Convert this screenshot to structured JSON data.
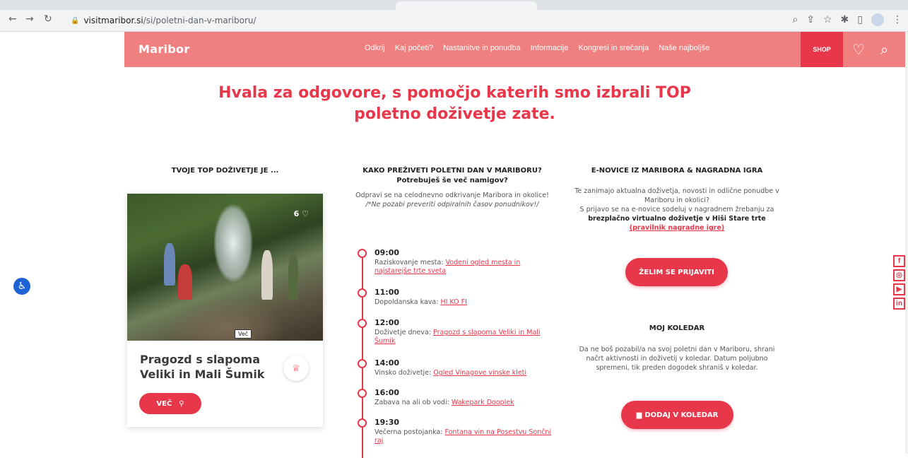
{
  "browser": {
    "url_domain": "visitmaribor.si",
    "url_path": "/si/poletni-dan-v-mariboru/"
  },
  "header": {
    "logo": "Maribor",
    "nav": [
      "Odkrij",
      "Kaj početi?",
      "Nastanitve in ponudba",
      "Informacije",
      "Kongresi in srečanja",
      "Naše najboljše"
    ],
    "shop": "SHOP"
  },
  "headline": {
    "line1": "Hvala za odgovore, s pomočjo katerih smo izbrali TOP",
    "line2": "poletno doživetje zate."
  },
  "left": {
    "title": "TVOJE TOP DOŽIVETJE JE ...",
    "card": {
      "likes": "6",
      "tag": "Več",
      "title": "Pragozd s slapoma Veliki in Mali Šumik",
      "button": "VEČ"
    }
  },
  "middle": {
    "title": "KAKO PREŽIVETI POLETNI DAN V MARIBORU?",
    "subtitle": "Potrebuješ še več namigov?",
    "intro": "Odpravi se na celodnevno odkrivanje Maribora in okolice!",
    "intro_italic": "/*Ne pozabi preveriti odpiralnih časov ponudnikov!/",
    "timeline": [
      {
        "time": "09:00",
        "label": "Raziskovanje mesta:",
        "link": "Vodeni ogled mesta in najstarejše trte sveta"
      },
      {
        "time": "11:00",
        "label": "Dopoldanska kava:",
        "link": "HI KO FI"
      },
      {
        "time": "12:00",
        "label": "Doživetje dneva:",
        "link": "Pragozd s slapoma Veliki in Mali Šumik"
      },
      {
        "time": "14:00",
        "label": "Vinsko doživetje:",
        "link": "Ogled Vinagove vinske kleti"
      },
      {
        "time": "16:00",
        "label": "Zabava na ali ob vodi:",
        "link": "Wakepark Dooplek"
      },
      {
        "time": "19:30",
        "label": "Večerna postojanka:",
        "link": "Fontana vin na Posestvu Sončni raj"
      }
    ]
  },
  "right": {
    "title": "E-NOVICE IZ MARIBORA & NAGRADNA IGRA",
    "text1": "Te zanimajo aktualna doživetja, novosti in odlične ponudbe v Mariboru in okolici?",
    "text2a": "S prijavo se na e-novice sodeluj v nagradnem žrebanju za",
    "text2b": "brezplačno virtualno doživetje v Hiši Stare trte",
    "text2link": "(pravilnik nagradne igre)",
    "signup_button": "ŽELIM SE PRIJAVITI",
    "calendar_title": "MOJ KOLEDAR",
    "calendar_text": "Da ne boš pozabil/a na svoj poletni dan v Mariboru, shrani načrt aktivnosti in doživetij v koledar. Datum poljubno spremeni, tik preden dogodek shraniš v koledar.",
    "calendar_button": "DODAJ V KOLEDAR"
  },
  "colors": {
    "brand": "#e8374a",
    "header_bg": "#f08080"
  }
}
